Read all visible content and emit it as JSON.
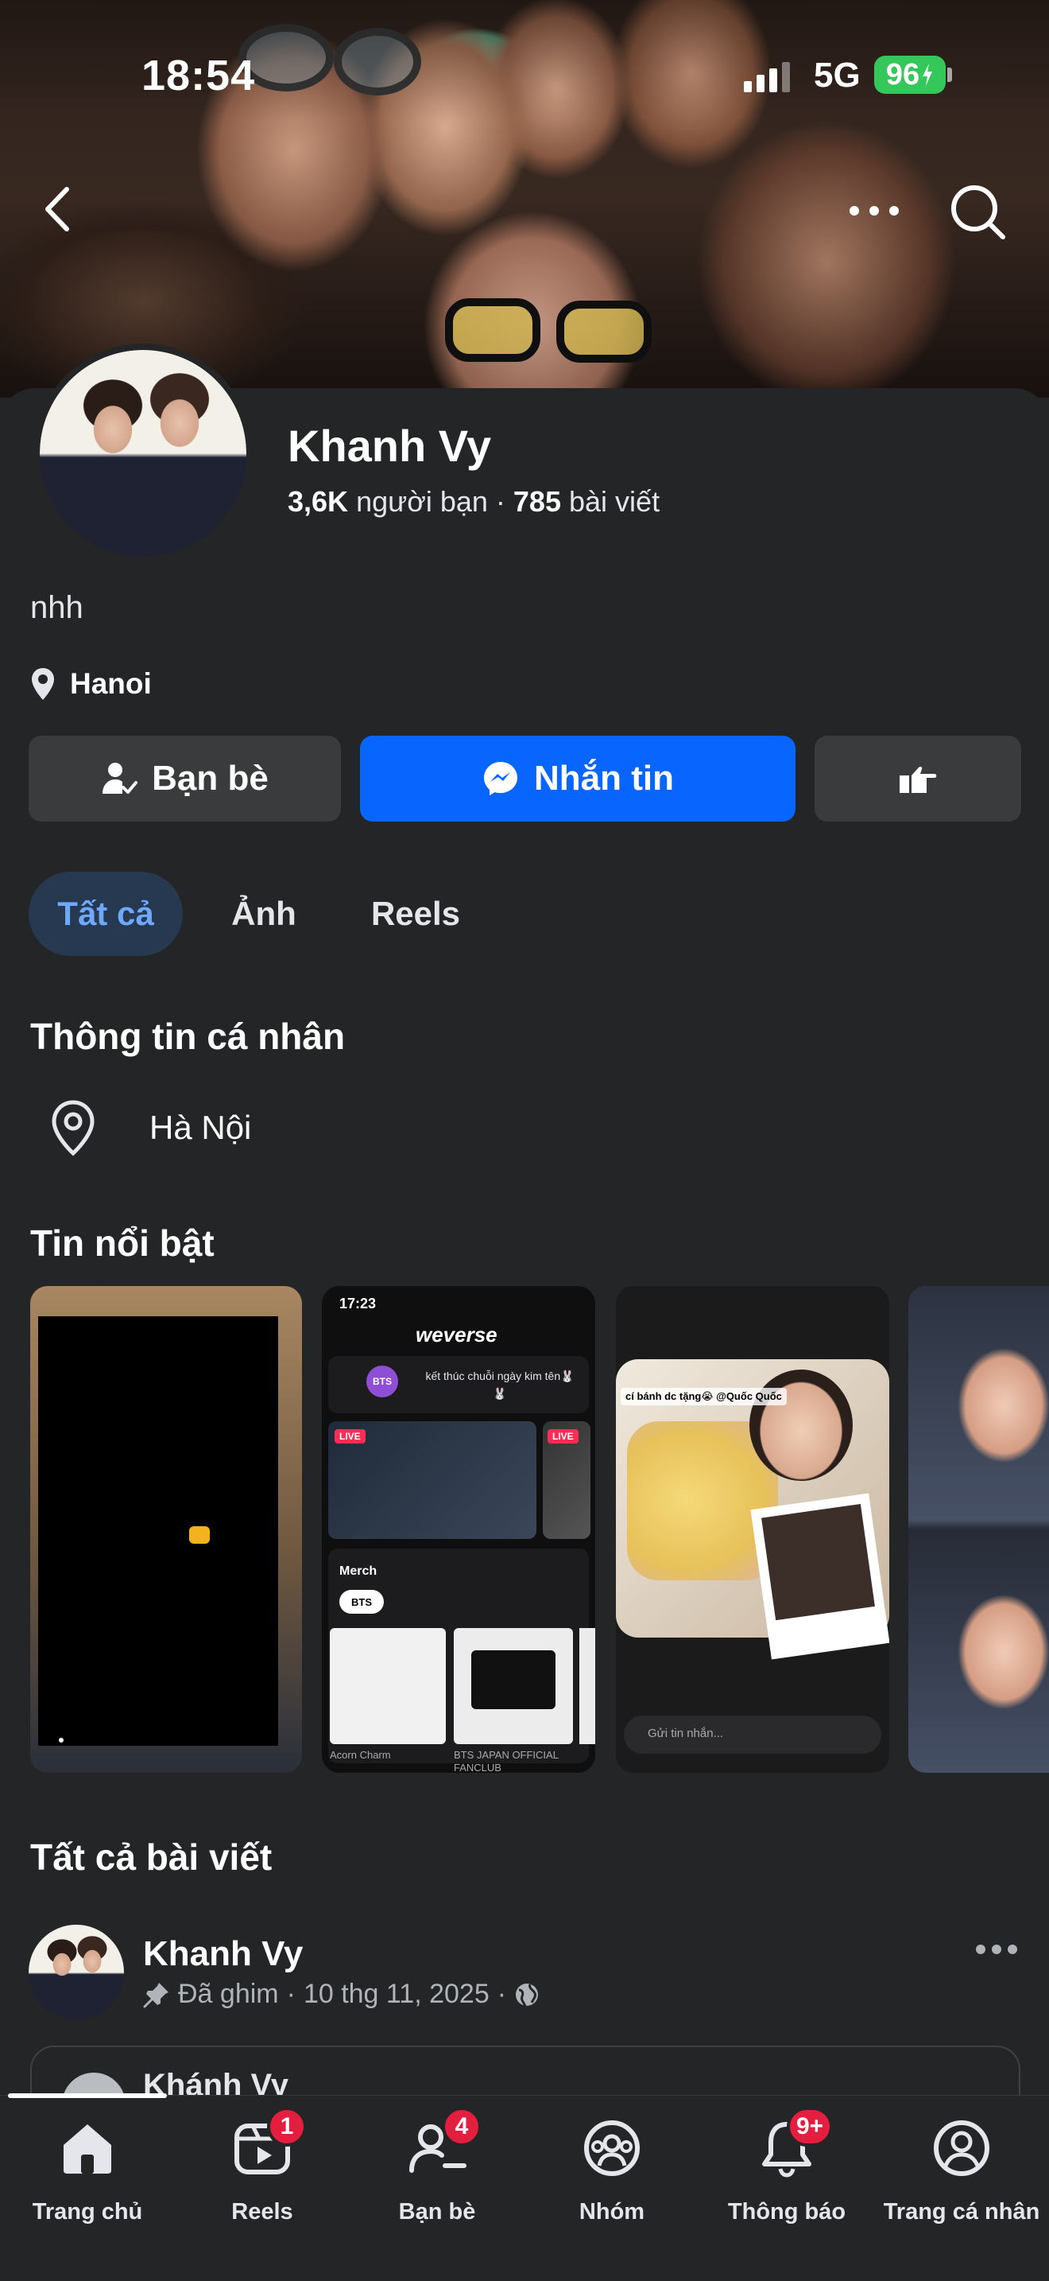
{
  "status_bar": {
    "time": "18:54",
    "network": "5G",
    "battery": "96"
  },
  "header": {
    "back_icon": "chevron-left-icon",
    "more_icon": "more-horizontal-icon",
    "search_icon": "search-icon"
  },
  "profile": {
    "name": "Khanh Vy",
    "friends_count": "3,6K",
    "friends_label": "người bạn",
    "posts_count": "785",
    "posts_label": "bài viết",
    "bio": "nhh",
    "location": "Hanoi"
  },
  "actions": {
    "friends_label": "Bạn bè",
    "message_label": "Nhắn tin",
    "poke_icon": "poke-hand-icon"
  },
  "tabs": [
    {
      "label": "Tất cả",
      "active": true
    },
    {
      "label": "Ảnh",
      "active": false
    },
    {
      "label": "Reels",
      "active": false
    }
  ],
  "about": {
    "title": "Thông tin cá nhân",
    "location": "Hà Nội"
  },
  "highlights": {
    "title": "Tin nổi bật",
    "story2": {
      "time": "17:23",
      "app": "weverse",
      "bts": "BTS",
      "row_text": "kết thúc chuỗi ngày kim tên🐰🐰",
      "live": "LIVE",
      "merch": "Merch",
      "pill": "BTS",
      "cap1": "Acorn Charm",
      "cap2": "BTS JAPAN OFFICIAL FANCLUB"
    },
    "story3": {
      "caption": "cí bánh dc tặng😭 @Quốc Quốc",
      "reply_placeholder": "Gửi tin nhắn..."
    }
  },
  "posts": {
    "title": "Tất cả bài viết",
    "items": [
      {
        "author": "Khanh Vy",
        "pinned": "Đã ghim",
        "date": "10 thg 11, 2025",
        "privacy_icon": "globe-icon",
        "shared_author": "Khánh Vy"
      }
    ]
  },
  "tabbar": [
    {
      "label": "Trang chủ",
      "icon": "home-icon",
      "badge": ""
    },
    {
      "label": "Reels",
      "icon": "reels-icon",
      "badge": "1"
    },
    {
      "label": "Bạn bè",
      "icon": "friends-icon",
      "badge": "4"
    },
    {
      "label": "Nhóm",
      "icon": "groups-icon",
      "badge": ""
    },
    {
      "label": "Thông báo",
      "icon": "bell-icon",
      "badge": "9+"
    },
    {
      "label": "Trang cá nhân",
      "icon": "profile-icon",
      "badge": ""
    }
  ],
  "colors": {
    "accent": "#0866ff",
    "background": "#242526",
    "button": "#3a3b3c",
    "badge": "#e41e3f",
    "battery": "#34c759"
  }
}
